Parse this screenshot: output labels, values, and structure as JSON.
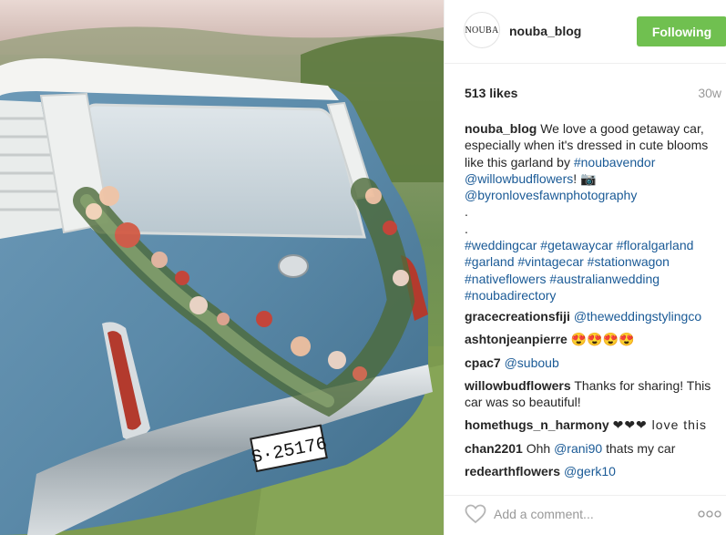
{
  "post": {
    "image_alt": "Blue vintage station wagon with a floral garland"
  },
  "header": {
    "avatar_text": "NOUBA",
    "username": "nouba_blog",
    "follow_label": "Following",
    "accent": "#70c050"
  },
  "stats": {
    "likes": "513 likes",
    "age": "30w"
  },
  "caption": {
    "author": "nouba_blog",
    "text1": " We love a good getaway car, especially when it's dressed in cute blooms like this garland by ",
    "tag1": "#noubavendor",
    "mention1": "@willowbudflowers",
    "text2": "! ",
    "camera": "📷",
    "mention2": "@byronlovesfawnphotography",
    "dot1": ".",
    "dot2": ".",
    "tags": [
      "#weddingcar",
      "#getawaycar",
      "#floralgarland",
      "#garland",
      "#vintagecar",
      "#stationwagon",
      "#nativeflowers",
      "#australianwedding",
      "#noubadirectory"
    ]
  },
  "comments": [
    {
      "user": "gracecreationsfiji",
      "mention": "@theweddingstylingco",
      "text": ""
    },
    {
      "user": "ashtonjeanpierre",
      "mention": "",
      "text": "😍😍😍😍"
    },
    {
      "user": "cpac7",
      "mention": "@suboub",
      "text": ""
    },
    {
      "user": "willowbudflowers",
      "mention": "",
      "text": "Thanks for sharing! This car was so beautiful!"
    },
    {
      "user": "homethugs_n_harmony",
      "mention": "",
      "text": "❤❤❤ love this"
    },
    {
      "user": "chan2201",
      "mention": "@rani90",
      "text": "Ohh",
      "text_after": "thats my car"
    },
    {
      "user": "redearthflowers",
      "mention": "@gerk10",
      "text": ""
    }
  ],
  "add_comment": {
    "placeholder": "Add a comment...",
    "like_icon": "heart-outline-icon",
    "more_icon": "more-options-icon"
  },
  "colors": {
    "link": "#1a5a96",
    "follow_button": "#70c050",
    "muted": "#999999"
  }
}
